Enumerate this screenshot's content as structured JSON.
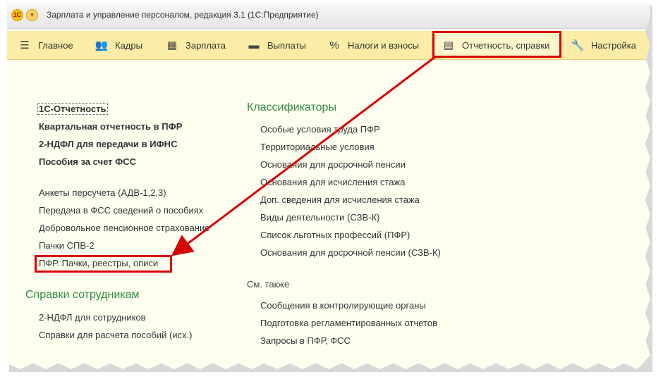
{
  "window": {
    "title": "Зарплата и управление персоналом, редакция 3.1  (1С:Предприятие)",
    "logo_text": "1С"
  },
  "sections": [
    {
      "label": "Главное",
      "icon": "menu-icon"
    },
    {
      "label": "Кадры",
      "icon": "people-icon"
    },
    {
      "label": "Зарплата",
      "icon": "calculator-icon"
    },
    {
      "label": "Выплаты",
      "icon": "wallet-icon"
    },
    {
      "label": "Налоги и взносы",
      "icon": "percent-icon"
    },
    {
      "label": "Отчетность, справки",
      "icon": "documents-icon"
    },
    {
      "label": "Настройка",
      "icon": "wrench-icon"
    }
  ],
  "left_links": [
    "1С-Отчетность",
    "Квартальная отчетность в ПФР",
    "2-НДФЛ для передачи в ИФНС",
    "Пособия за счет ФСС",
    "Анкеты персучета (АДВ-1,2,3)",
    "Передача в ФСС сведений о пособиях",
    "Добровольное пенсионное страхование",
    "Пачки СПВ-2",
    "ПФР. Пачки, реестры, описи"
  ],
  "employee_refs": {
    "title": "Справки сотрудникам",
    "items": [
      "2-НДФЛ для сотрудников",
      "Справки для расчета пособий (исх.)"
    ]
  },
  "classifiers": {
    "title": "Классификаторы",
    "items": [
      "Особые условия труда ПФР",
      "Территориальные условия",
      "Основания для досрочной пенсии",
      "Основания для исчисления стажа",
      "Доп. сведения для исчисления стажа",
      "Виды деятельности (СЗВ-К)",
      "Список льготных профессий (ПФР)",
      "Основания для досрочной пенсии (СЗВ-К)"
    ]
  },
  "see_also": {
    "title": "См. также",
    "items": [
      "Сообщения в контролирующие органы",
      "Подготовка регламентированных отчетов",
      "Запросы в ПФР, ФСС"
    ]
  },
  "colors": {
    "section_bar": "#fbeda7",
    "highlight": "#d90000",
    "group_title": "#2e8b40",
    "background": "#fffff0"
  }
}
